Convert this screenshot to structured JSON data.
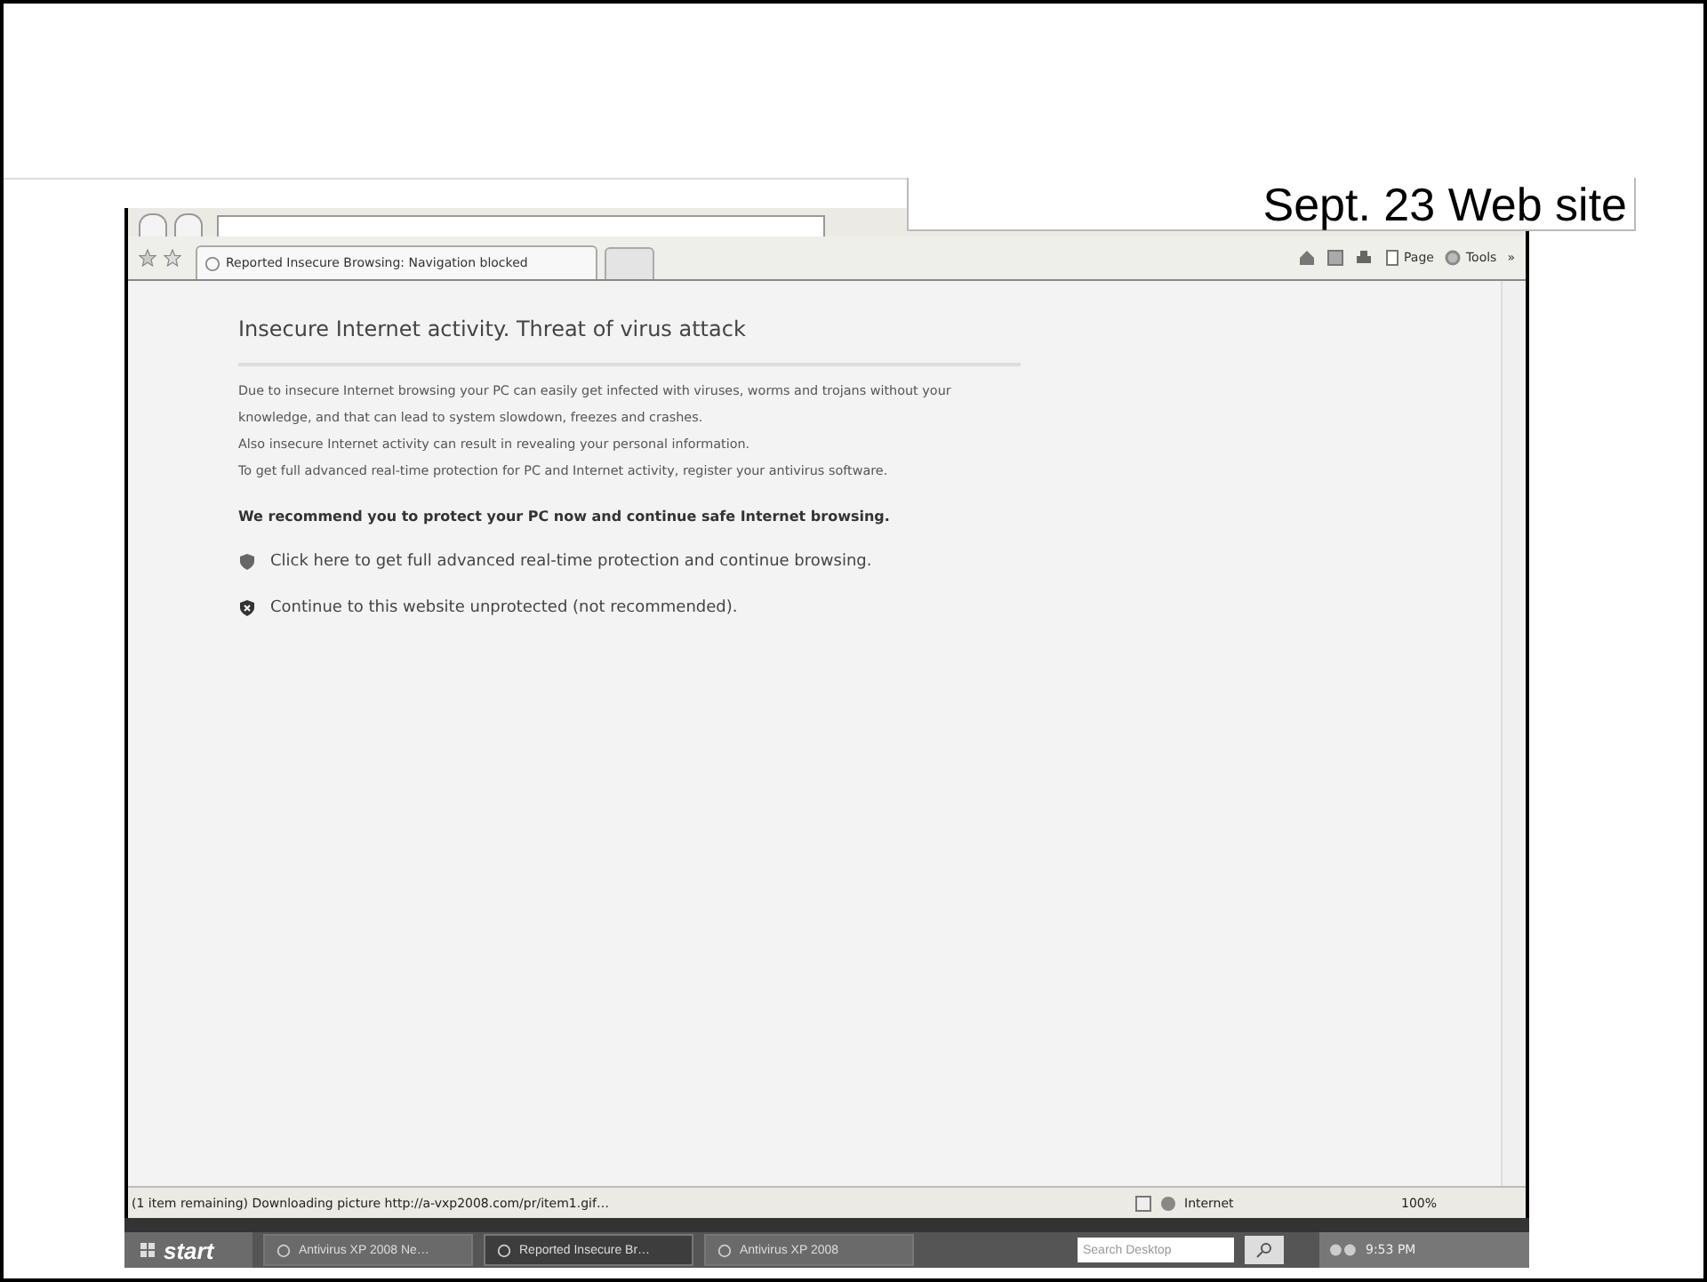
{
  "caption": "Sept. 23 Web site",
  "browser": {
    "tab": {
      "title": "Reported Insecure Browsing: Navigation blocked",
      "selected": true
    },
    "commands": [
      {
        "kind": "home"
      },
      {
        "kind": "feeds"
      },
      {
        "kind": "print"
      },
      {
        "kind": "page",
        "label": "Page"
      },
      {
        "kind": "tools",
        "label": "Tools"
      },
      {
        "kind": "more",
        "label": "»"
      }
    ]
  },
  "page": {
    "heading": "Insecure Internet activity. Threat of virus attack",
    "paragraphs": [
      "Due to insecure Internet browsing your PC can easily get infected with viruses, worms and trojans without your knowledge, and that can lead to system slowdown, freezes and crashes.",
      "Also insecure Internet activity can result in revealing your personal information.",
      "To get full advanced real-time protection for PC and Internet activity, register your antivirus software."
    ],
    "recommendation": "We recommend you to protect your PC now and continue safe Internet browsing.",
    "options": [
      {
        "kind": "protect",
        "text": "Click here to get full advanced real-time protection and continue browsing."
      },
      {
        "kind": "unprotected",
        "text": "Continue to this website unprotected (not recommended)."
      }
    ]
  },
  "status_bar": {
    "message": "(1 item remaining) Downloading picture http://a-vxp2008.com/pr/item1.gif…",
    "zone": "Internet",
    "zoom": "100%"
  },
  "taskbar": {
    "start": "start",
    "tasks": [
      {
        "label": "Antivirus XP 2008 Ne…",
        "selected": false
      },
      {
        "label": "Reported Insecure Br…",
        "selected": true
      },
      {
        "label": "Antivirus XP 2008",
        "selected": false
      }
    ],
    "search_placeholder": "Search Desktop",
    "clock": "9:53 PM"
  }
}
